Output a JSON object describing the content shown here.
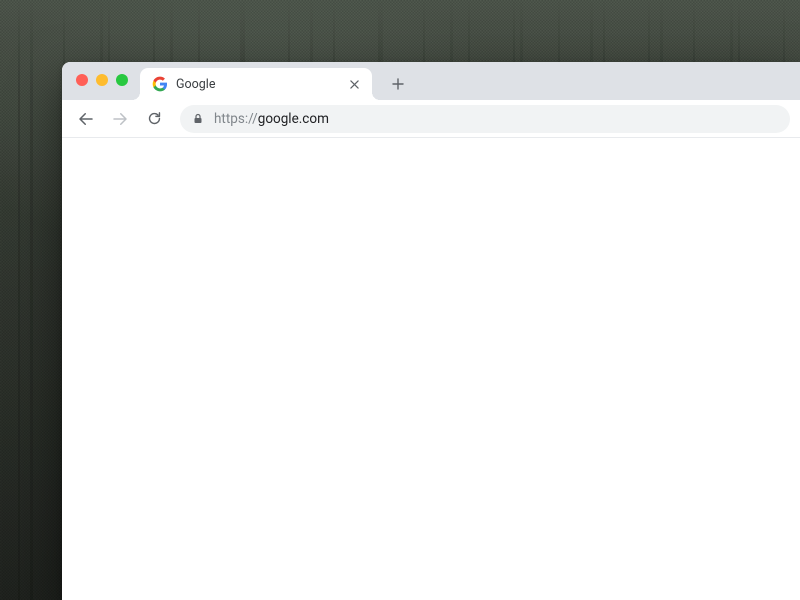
{
  "tab": {
    "title": "Google",
    "favicon": "google-g"
  },
  "address": {
    "protocol": "https://",
    "host": "google.com"
  },
  "colors": {
    "chrome_bg": "#DEE1E6",
    "traffic_red": "#FF5F57",
    "traffic_yellow": "#FEBC2E",
    "traffic_green": "#28C840"
  }
}
